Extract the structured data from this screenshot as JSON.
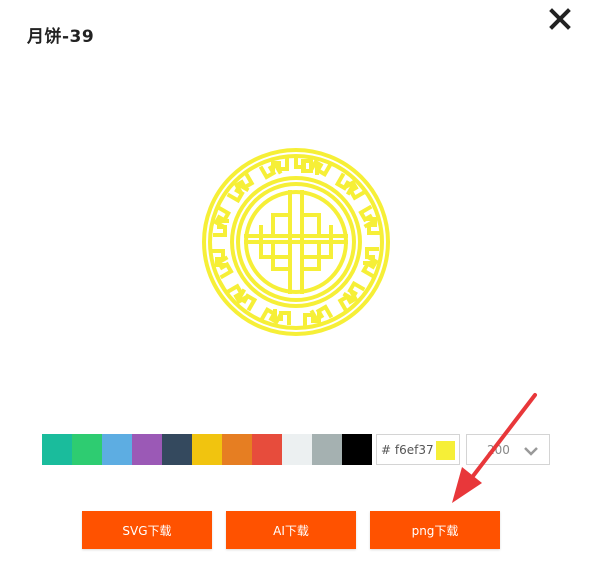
{
  "dialog": {
    "title": "月饼-39",
    "close_icon": "close-icon"
  },
  "preview": {
    "icon": "mooncake-emblem-icon",
    "color": "#f6ef37"
  },
  "palette": {
    "swatches": [
      "#1abc9c",
      "#2ecc71",
      "#5dade2",
      "#9b59b6",
      "#34495e",
      "#f1c40f",
      "#e67e22",
      "#e74c3c",
      "#ecf0f1",
      "#a5b1b1",
      "#000000"
    ]
  },
  "color_input": {
    "value": "# f6ef37",
    "chip_color": "#f6ef37"
  },
  "size_select": {
    "value": "200"
  },
  "buttons": {
    "svg_label": "SVG下载",
    "ai_label": "AI下载",
    "png_label": "png下载"
  },
  "annotation": {
    "arrow_color": "#e8373a"
  }
}
